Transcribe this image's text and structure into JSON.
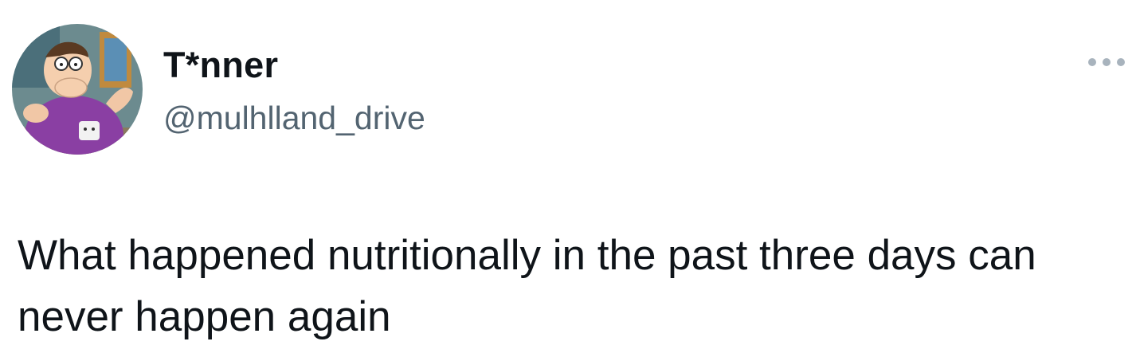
{
  "tweet": {
    "author": {
      "display_name": "T*nner",
      "handle": "@mulhlland_drive",
      "avatar_icon": "cartoon-character-avatar-icon"
    },
    "more_icon": "more-horizontal-icon",
    "text": "What happened nutritionally in the past three days can never happen again"
  },
  "colors": {
    "name": "#0f1419",
    "handle": "#536471",
    "more_icon": "#a8b3bd",
    "avatar_shirt": "#8a3fa3",
    "avatar_background": "#4e7a85"
  }
}
